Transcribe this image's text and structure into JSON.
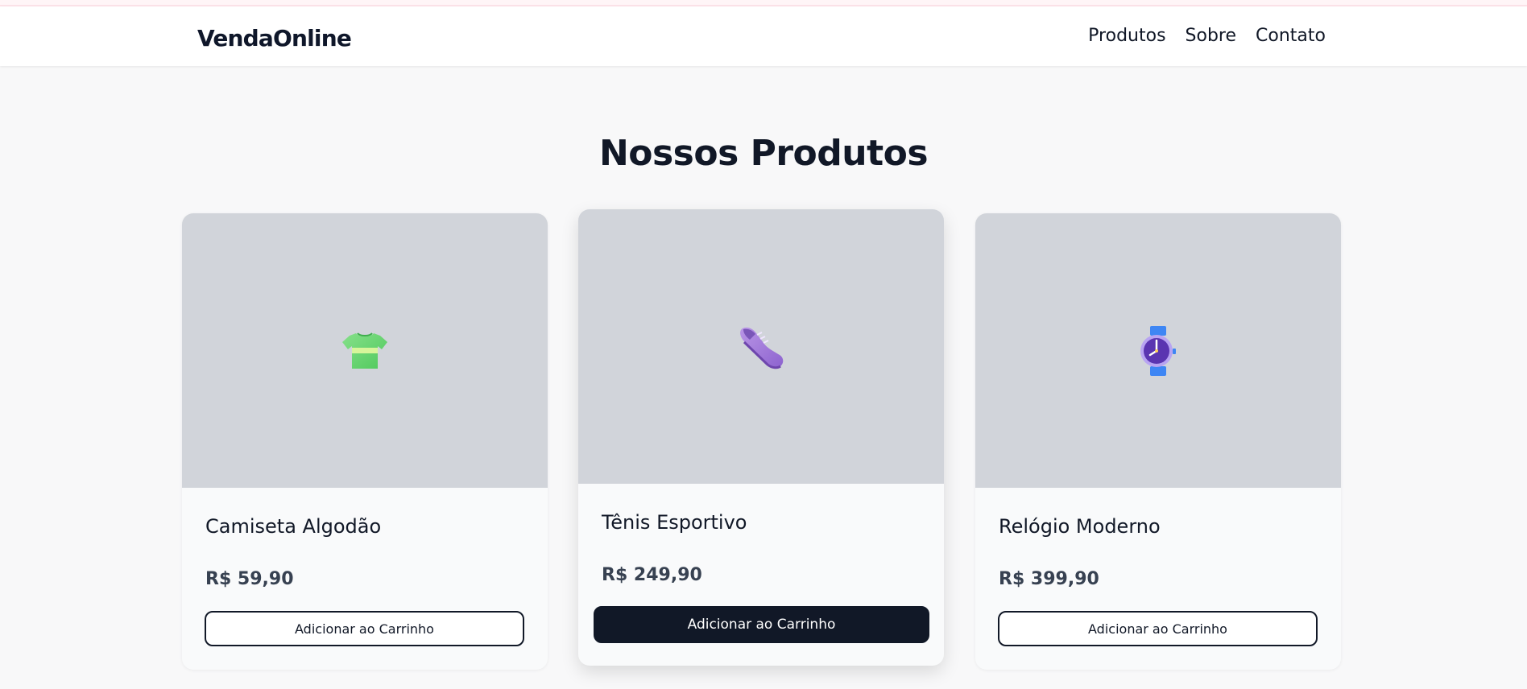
{
  "brand": "VendaOnline",
  "nav": {
    "items": [
      "Produtos",
      "Sobre",
      "Contato"
    ]
  },
  "page": {
    "title": "Nossos Produtos"
  },
  "products": [
    {
      "name": "Camiseta Algodão",
      "price": "R$ 59,90",
      "button_label": "Adicionar ao Carrinho",
      "icon": "tshirt-icon"
    },
    {
      "name": "Tênis Esportivo",
      "price": "R$ 249,90",
      "button_label": "Adicionar ao Carrinho",
      "icon": "sneaker-icon"
    },
    {
      "name": "Relógio Moderno",
      "price": "R$ 399,90",
      "button_label": "Adicionar ao Carrinho",
      "icon": "watch-icon"
    }
  ],
  "colors": {
    "primary": "#111827",
    "background": "#f8f8f9",
    "image_placeholder": "#d1d4da",
    "card_background": "#f9fafb"
  }
}
